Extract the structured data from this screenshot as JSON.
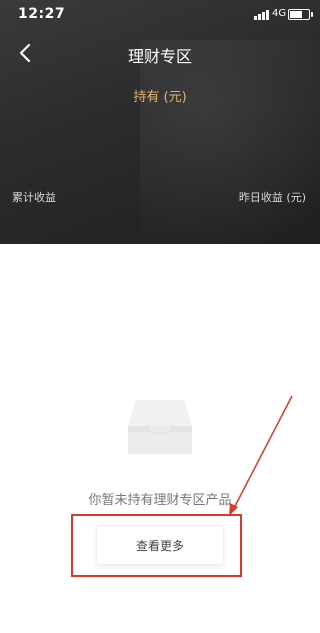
{
  "status_bar": {
    "time": "12:27",
    "network": "4G"
  },
  "nav": {
    "title": "理财专区",
    "back_icon": "chevron-left-icon"
  },
  "summary": {
    "holding_label": "持有 (元)",
    "cumulative_income_label": "累计收益",
    "yesterday_income_label": "昨日收益 (元)"
  },
  "empty_state": {
    "icon": "empty-tray-icon",
    "message": "你暂未持有理财专区产品",
    "view_more_label": "查看更多"
  },
  "annotation": {
    "color": "#d93a2b"
  },
  "colors": {
    "header_bg": "#2b2b2d",
    "accent_gold": "#e0b36a"
  }
}
